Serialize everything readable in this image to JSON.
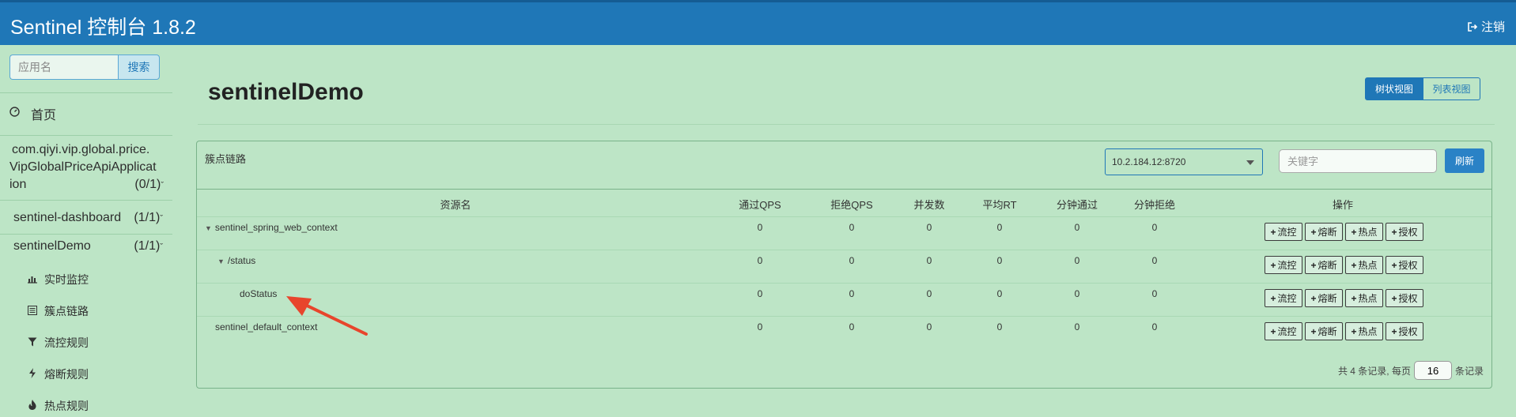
{
  "header": {
    "title": "Sentinel 控制台 1.8.2",
    "logout_label": "注销"
  },
  "sidebar": {
    "search_placeholder": "应用名",
    "search_button": "搜索",
    "home_label": "首页",
    "apps": [
      {
        "name_lines": [
          "com.qiyi.vip.global.price.",
          "VipGlobalPriceApiApplicat",
          "ion"
        ],
        "count": "(0/1)"
      },
      {
        "name": "sentinel-dashboard",
        "count": "(1/1)"
      },
      {
        "name": "sentinelDemo",
        "count": "(1/1)"
      }
    ],
    "sub_items": [
      {
        "label": "实时监控",
        "icon": "bar-chart-icon"
      },
      {
        "label": "簇点链路",
        "icon": "list-icon"
      },
      {
        "label": "流控规则",
        "icon": "filter-icon"
      },
      {
        "label": "熔断规则",
        "icon": "bolt-icon"
      },
      {
        "label": "热点规则",
        "icon": "fire-icon"
      }
    ]
  },
  "main": {
    "page_title": "sentinelDemo",
    "view_tree": "树状视图",
    "view_list": "列表视图",
    "panel_title": "簇点链路",
    "machine_selected": "10.2.184.12:8720",
    "keyword_placeholder": "关键字",
    "refresh_label": "刷新",
    "columns": [
      "资源名",
      "通过QPS",
      "拒绝QPS",
      "并发数",
      "平均RT",
      "分钟通过",
      "分钟拒绝",
      "操作"
    ],
    "rows": [
      {
        "name": "sentinel_spring_web_context",
        "expandable": true,
        "values": [
          "0",
          "0",
          "0",
          "0",
          "0",
          "0"
        ]
      },
      {
        "name": "/status",
        "expandable": true,
        "values": [
          "0",
          "0",
          "0",
          "0",
          "0",
          "0"
        ]
      },
      {
        "name": "doStatus",
        "expandable": false,
        "values": [
          "0",
          "0",
          "0",
          "0",
          "0",
          "0"
        ]
      },
      {
        "name": "sentinel_default_context",
        "expandable": false,
        "values": [
          "0",
          "0",
          "0",
          "0",
          "0",
          "0"
        ]
      }
    ],
    "ops": [
      "流控",
      "熔断",
      "热点",
      "授权"
    ],
    "pager": {
      "prefix": "共 4 条记录, 每页",
      "page_size": "16",
      "suffix": "条记录"
    }
  },
  "colors": {
    "header_bg": "#1f77b7",
    "page_bg": "#bde5c6",
    "arrow": "#e8452c"
  }
}
